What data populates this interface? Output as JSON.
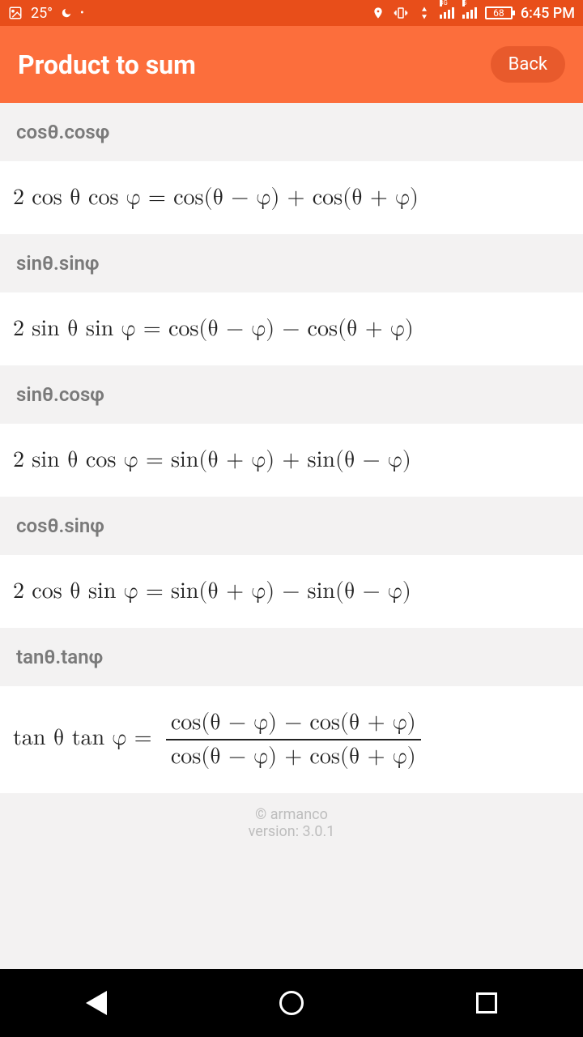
{
  "statusbar": {
    "temp": "25°",
    "battery": "68",
    "time": "6:45 PM",
    "net1": "3G",
    "net2": "G"
  },
  "appbar": {
    "title": "Product to sum",
    "back": "Back"
  },
  "sections": [
    {
      "label": "cosθ.cosφ",
      "formula": "2 cos θ cos φ = cos(θ − φ) + cos(θ + φ)"
    },
    {
      "label": "sinθ.sinφ",
      "formula": "2 sin θ sin φ = cos(θ − φ) − cos(θ + φ)"
    },
    {
      "label": "sinθ.cosφ",
      "formula": "2 sin θ cos φ = sin(θ + φ) + sin(θ − φ)"
    },
    {
      "label": "cosθ.sinφ",
      "formula": "2 cos θ sin φ = sin(θ + φ) − sin(θ − φ)"
    },
    {
      "label": "tanθ.tanφ",
      "formula_frac": {
        "lhs": "tan θ tan φ =",
        "num": "cos(θ − φ) − cos(θ + φ)",
        "den": "cos(θ − φ) + cos(θ + φ)"
      }
    }
  ],
  "footer": {
    "line1": "© armanco",
    "line2": "version: 3.0.1"
  }
}
